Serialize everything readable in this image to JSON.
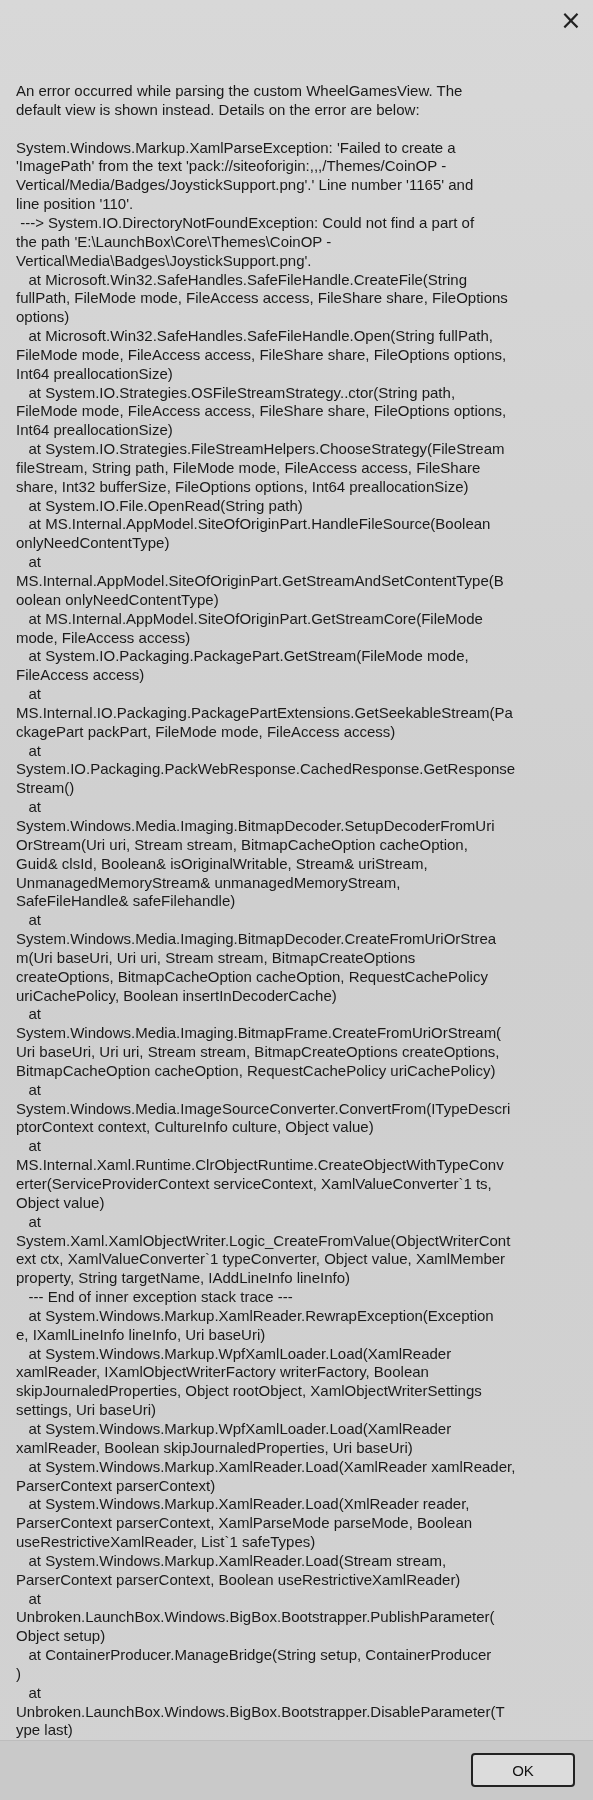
{
  "close_button": "×",
  "message": [
    "An error occurred while parsing the custom WheelGamesView. The",
    "default view is shown instead. Details on the error are below:"
  ],
  "details": [
    "System.Windows.Markup.XamlParseException: 'Failed to create a",
    "'ImagePath' from the text 'pack://siteoforigin:,,,/Themes/CoinOP -",
    "Vertical/Media/Badges/JoystickSupport.png'.' Line number '1165' and",
    "line position '110'.",
    " ---> System.IO.DirectoryNotFoundException: Could not find a part of",
    "the path 'E:\\LaunchBox\\Core\\Themes\\CoinOP -",
    "Vertical\\Media\\Badges\\JoystickSupport.png'.",
    "   at Microsoft.Win32.SafeHandles.SafeFileHandle.CreateFile(String",
    "fullPath, FileMode mode, FileAccess access, FileShare share, FileOptions",
    "options)",
    "   at Microsoft.Win32.SafeHandles.SafeFileHandle.Open(String fullPath,",
    "FileMode mode, FileAccess access, FileShare share, FileOptions options,",
    "Int64 preallocationSize)",
    "   at System.IO.Strategies.OSFileStreamStrategy..ctor(String path,",
    "FileMode mode, FileAccess access, FileShare share, FileOptions options,",
    "Int64 preallocationSize)",
    "   at System.IO.Strategies.FileStreamHelpers.ChooseStrategy(FileStream",
    "fileStream, String path, FileMode mode, FileAccess access, FileShare",
    "share, Int32 bufferSize, FileOptions options, Int64 preallocationSize)",
    "   at System.IO.File.OpenRead(String path)",
    "   at MS.Internal.AppModel.SiteOfOriginPart.HandleFileSource(Boolean",
    "onlyNeedContentType)",
    "   at",
    "MS.Internal.AppModel.SiteOfOriginPart.GetStreamAndSetContentType(B",
    "oolean onlyNeedContentType)",
    "   at MS.Internal.AppModel.SiteOfOriginPart.GetStreamCore(FileMode",
    "mode, FileAccess access)",
    "   at System.IO.Packaging.PackagePart.GetStream(FileMode mode,",
    "FileAccess access)",
    "   at",
    "MS.Internal.IO.Packaging.PackagePartExtensions.GetSeekableStream(Pa",
    "ckagePart packPart, FileMode mode, FileAccess access)",
    "   at",
    "System.IO.Packaging.PackWebResponse.CachedResponse.GetResponse",
    "Stream()",
    "   at",
    "System.Windows.Media.Imaging.BitmapDecoder.SetupDecoderFromUri",
    "OrStream(Uri uri, Stream stream, BitmapCacheOption cacheOption,",
    "Guid& clsId, Boolean& isOriginalWritable, Stream& uriStream,",
    "UnmanagedMemoryStream& unmanagedMemoryStream,",
    "SafeFileHandle& safeFilehandle)",
    "   at",
    "System.Windows.Media.Imaging.BitmapDecoder.CreateFromUriOrStrea",
    "m(Uri baseUri, Uri uri, Stream stream, BitmapCreateOptions",
    "createOptions, BitmapCacheOption cacheOption, RequestCachePolicy",
    "uriCachePolicy, Boolean insertInDecoderCache)",
    "   at",
    "System.Windows.Media.Imaging.BitmapFrame.CreateFromUriOrStream(",
    "Uri baseUri, Uri uri, Stream stream, BitmapCreateOptions createOptions,",
    "BitmapCacheOption cacheOption, RequestCachePolicy uriCachePolicy)",
    "   at",
    "System.Windows.Media.ImageSourceConverter.ConvertFrom(ITypeDescri",
    "ptorContext context, CultureInfo culture, Object value)",
    "   at",
    "MS.Internal.Xaml.Runtime.ClrObjectRuntime.CreateObjectWithTypeConv",
    "erter(ServiceProviderContext serviceContext, XamlValueConverter`1 ts,",
    "Object value)",
    "   at",
    "System.Xaml.XamlObjectWriter.Logic_CreateFromValue(ObjectWriterCont",
    "ext ctx, XamlValueConverter`1 typeConverter, Object value, XamlMember",
    "property, String targetName, IAddLineInfo lineInfo)",
    "   --- End of inner exception stack trace ---",
    "   at System.Windows.Markup.XamlReader.RewrapException(Exception",
    "e, IXamlLineInfo lineInfo, Uri baseUri)",
    "   at System.Windows.Markup.WpfXamlLoader.Load(XamlReader",
    "xamlReader, IXamlObjectWriterFactory writerFactory, Boolean",
    "skipJournaledProperties, Object rootObject, XamlObjectWriterSettings",
    "settings, Uri baseUri)",
    "   at System.Windows.Markup.WpfXamlLoader.Load(XamlReader",
    "xamlReader, Boolean skipJournaledProperties, Uri baseUri)",
    "   at System.Windows.Markup.XamlReader.Load(XamlReader xamlReader,",
    "ParserContext parserContext)",
    "   at System.Windows.Markup.XamlReader.Load(XmlReader reader,",
    "ParserContext parserContext, XamlParseMode parseMode, Boolean",
    "useRestrictiveXamlReader, List`1 safeTypes)",
    "   at System.Windows.Markup.XamlReader.Load(Stream stream,",
    "ParserContext parserContext, Boolean useRestrictiveXamlReader)",
    "   at",
    "Unbroken.LaunchBox.Windows.BigBox.Bootstrapper.PublishParameter(",
    "Object setup)",
    "   at ContainerProducer.ManageBridge(String setup, ContainerProducer",
    ")",
    "   at",
    "Unbroken.LaunchBox.Windows.BigBox.Bootstrapper.DisableParameter(T",
    "ype last)"
  ],
  "ok_button": "OK"
}
